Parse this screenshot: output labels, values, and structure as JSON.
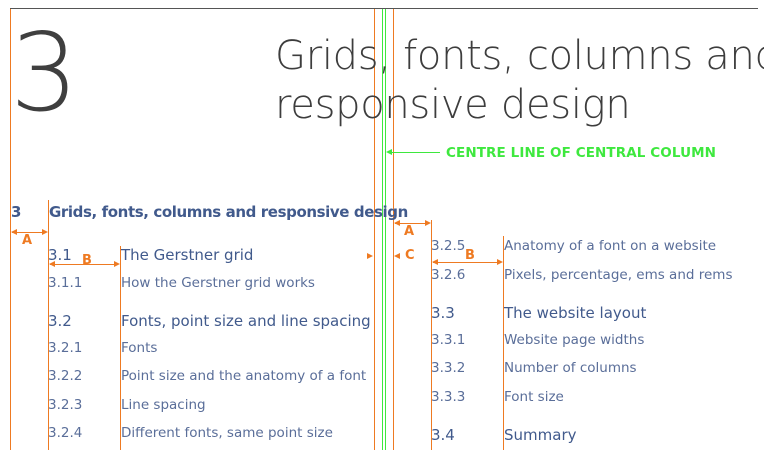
{
  "chapter": {
    "number": "3",
    "title_line1": "Grids, fonts, columns and",
    "title_line2": "responsive design"
  },
  "annotation": {
    "centre_label": "CENTRE LINE OF CENTRAL COLUMN"
  },
  "toc_heading": {
    "number": "3",
    "title": "Grids, fonts, columns and responsive design"
  },
  "left_column": [
    {
      "number": "3.1",
      "title": "The Gerstner grid",
      "level": "main"
    },
    {
      "number": "3.1.1",
      "title": "How the Gerstner grid works",
      "level": "sub"
    },
    {
      "number": "3.2",
      "title": "Fonts, point size and line spacing",
      "level": "main"
    },
    {
      "number": "3.2.1",
      "title": "Fonts",
      "level": "sub"
    },
    {
      "number": "3.2.2",
      "title": "Point size and the anatomy of a font",
      "level": "sub"
    },
    {
      "number": "3.2.3",
      "title": "Line spacing",
      "level": "sub"
    },
    {
      "number": "3.2.4",
      "title": "Different fonts, same point size",
      "level": "sub"
    }
  ],
  "right_column": [
    {
      "number": "3.2.5",
      "title": "Anatomy of a font on a website",
      "level": "sub"
    },
    {
      "number": "3.2.6",
      "title": "Pixels, percentage, ems and rems",
      "level": "sub"
    },
    {
      "number": "3.3",
      "title": "The website layout",
      "level": "main"
    },
    {
      "number": "3.3.1",
      "title": "Website page widths",
      "level": "sub"
    },
    {
      "number": "3.3.2",
      "title": "Number of columns",
      "level": "sub"
    },
    {
      "number": "3.3.3",
      "title": "Font size",
      "level": "sub"
    },
    {
      "number": "3.4",
      "title": "Summary",
      "level": "main"
    }
  ],
  "dimension_labels": {
    "a_left": "A",
    "b_left": "B",
    "c_centre": "C",
    "a_right": "A",
    "b_right": "B"
  },
  "colors": {
    "guide_orange": "#ee7a22",
    "centre_green": "#3ee83e",
    "text_blue": "#415a8c",
    "title_grey": "#3d3d3d"
  }
}
